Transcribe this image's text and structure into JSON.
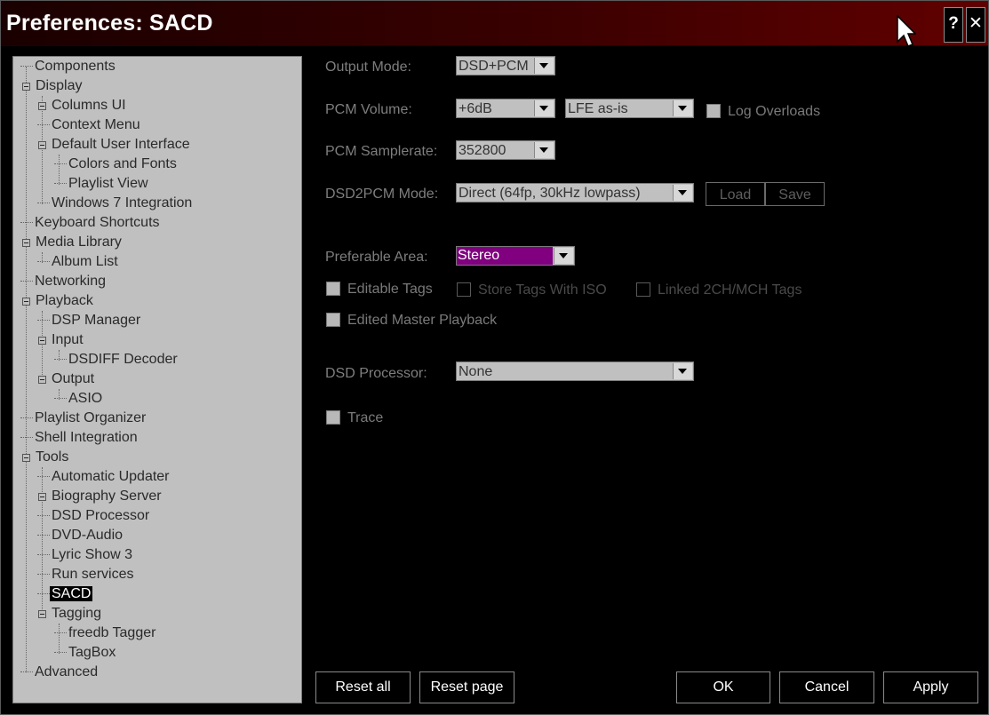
{
  "window": {
    "title": "Preferences: SACD",
    "help_label": "?",
    "close_label": "✕"
  },
  "tree": {
    "items": [
      {
        "label": "Components"
      },
      {
        "label": "Display"
      },
      {
        "label": "Columns UI"
      },
      {
        "label": "Context Menu"
      },
      {
        "label": "Default User Interface"
      },
      {
        "label": "Colors and Fonts"
      },
      {
        "label": "Playlist View"
      },
      {
        "label": "Windows 7 Integration"
      },
      {
        "label": "Keyboard Shortcuts"
      },
      {
        "label": "Media Library"
      },
      {
        "label": "Album List"
      },
      {
        "label": "Networking"
      },
      {
        "label": "Playback"
      },
      {
        "label": "DSP Manager"
      },
      {
        "label": "Input"
      },
      {
        "label": "DSDIFF Decoder"
      },
      {
        "label": "Output"
      },
      {
        "label": "ASIO"
      },
      {
        "label": "Playlist Organizer"
      },
      {
        "label": "Shell Integration"
      },
      {
        "label": "Tools"
      },
      {
        "label": "Automatic Updater"
      },
      {
        "label": "Biography Server"
      },
      {
        "label": "DSD Processor"
      },
      {
        "label": "DVD-Audio"
      },
      {
        "label": "Lyric Show 3"
      },
      {
        "label": "Run services"
      },
      {
        "label": "SACD"
      },
      {
        "label": "Tagging"
      },
      {
        "label": "freedb Tagger"
      },
      {
        "label": "TagBox"
      },
      {
        "label": "Advanced"
      }
    ]
  },
  "settings": {
    "output_mode_label": "Output Mode:",
    "output_mode_value": "DSD+PCM",
    "pcm_volume_label": "PCM Volume:",
    "pcm_volume_value": "+6dB",
    "lfe_value": "LFE as-is",
    "log_overloads_label": "Log Overloads",
    "pcm_samplerate_label": "PCM Samplerate:",
    "pcm_samplerate_value": "352800",
    "dsd2pcm_mode_label": "DSD2PCM Mode:",
    "dsd2pcm_mode_value": "Direct (64fp, 30kHz lowpass)",
    "load_label": "Load",
    "save_label": "Save",
    "preferable_area_label": "Preferable Area:",
    "preferable_area_value": "Stereo",
    "editable_tags_label": "Editable Tags",
    "store_tags_label": "Store Tags With ISO",
    "linked_tags_label": "Linked 2CH/MCH Tags",
    "edited_master_label": "Edited Master Playback",
    "dsd_processor_label": "DSD Processor:",
    "dsd_processor_value": "None",
    "trace_label": "Trace"
  },
  "buttons": {
    "reset_all": "Reset all",
    "reset_page": "Reset page",
    "ok": "OK",
    "cancel": "Cancel",
    "apply": "Apply"
  },
  "colors": {
    "selection_bg": "#000000",
    "highlight_value_bg": "#800080",
    "title_gradient_end": "#610000"
  }
}
